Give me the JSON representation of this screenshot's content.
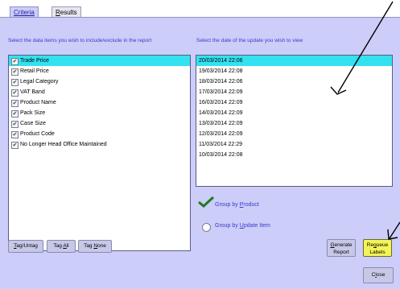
{
  "tabs": [
    {
      "label": "Criteria",
      "underline": "C",
      "rest": "riteria"
    },
    {
      "label": "Results",
      "underline": "R",
      "rest": "esults"
    }
  ],
  "left_label": "Select the data items you wish to include/exclude in the report",
  "right_label": "Select the date of the update you wish to view",
  "data_items": [
    "Trade Price",
    "Retail Price",
    "Legal Category",
    "VAT Band",
    "Product Name",
    "Pack Size",
    "Case Size",
    "Product Code",
    "No Longer Head Office Maintained"
  ],
  "dates": [
    "20/03/2014 22:06",
    "19/03/2014 22:08",
    "18/03/2014 22:06",
    "17/03/2014 22:09",
    "16/03/2014 22:09",
    "14/03/2014 22:09",
    "13/03/2014 22:09",
    "12/03/2014 22:09",
    "11/03/2014 22:29",
    "10/03/2014 22:08"
  ],
  "group_by_product": {
    "prefix": "Group by ",
    "u": "P",
    "rest": "roduct"
  },
  "group_by_update": {
    "prefix": "Group by ",
    "u": "U",
    "rest": "pdate Item"
  },
  "buttons": {
    "tag_untag": {
      "u": "T",
      "rest": "ag/Untag"
    },
    "tag_all": {
      "pre": "Tag ",
      "u": "A",
      "rest": "ll"
    },
    "tag_none": {
      "pre": "Tag ",
      "u": "N",
      "rest": "one"
    },
    "generate": {
      "u": "G",
      "rest": "enerate",
      "line2": "Report"
    },
    "requeue": {
      "pre": "Re",
      "u": "q",
      "rest": "ueue",
      "line2": "Labels"
    },
    "close": {
      "pre": "C",
      "u": "l",
      "rest": "ose"
    }
  },
  "colors": {
    "panel": "#cccdf8",
    "selected": "#33e1ef",
    "requeue": "#f4f458",
    "annotation": "#000000"
  }
}
